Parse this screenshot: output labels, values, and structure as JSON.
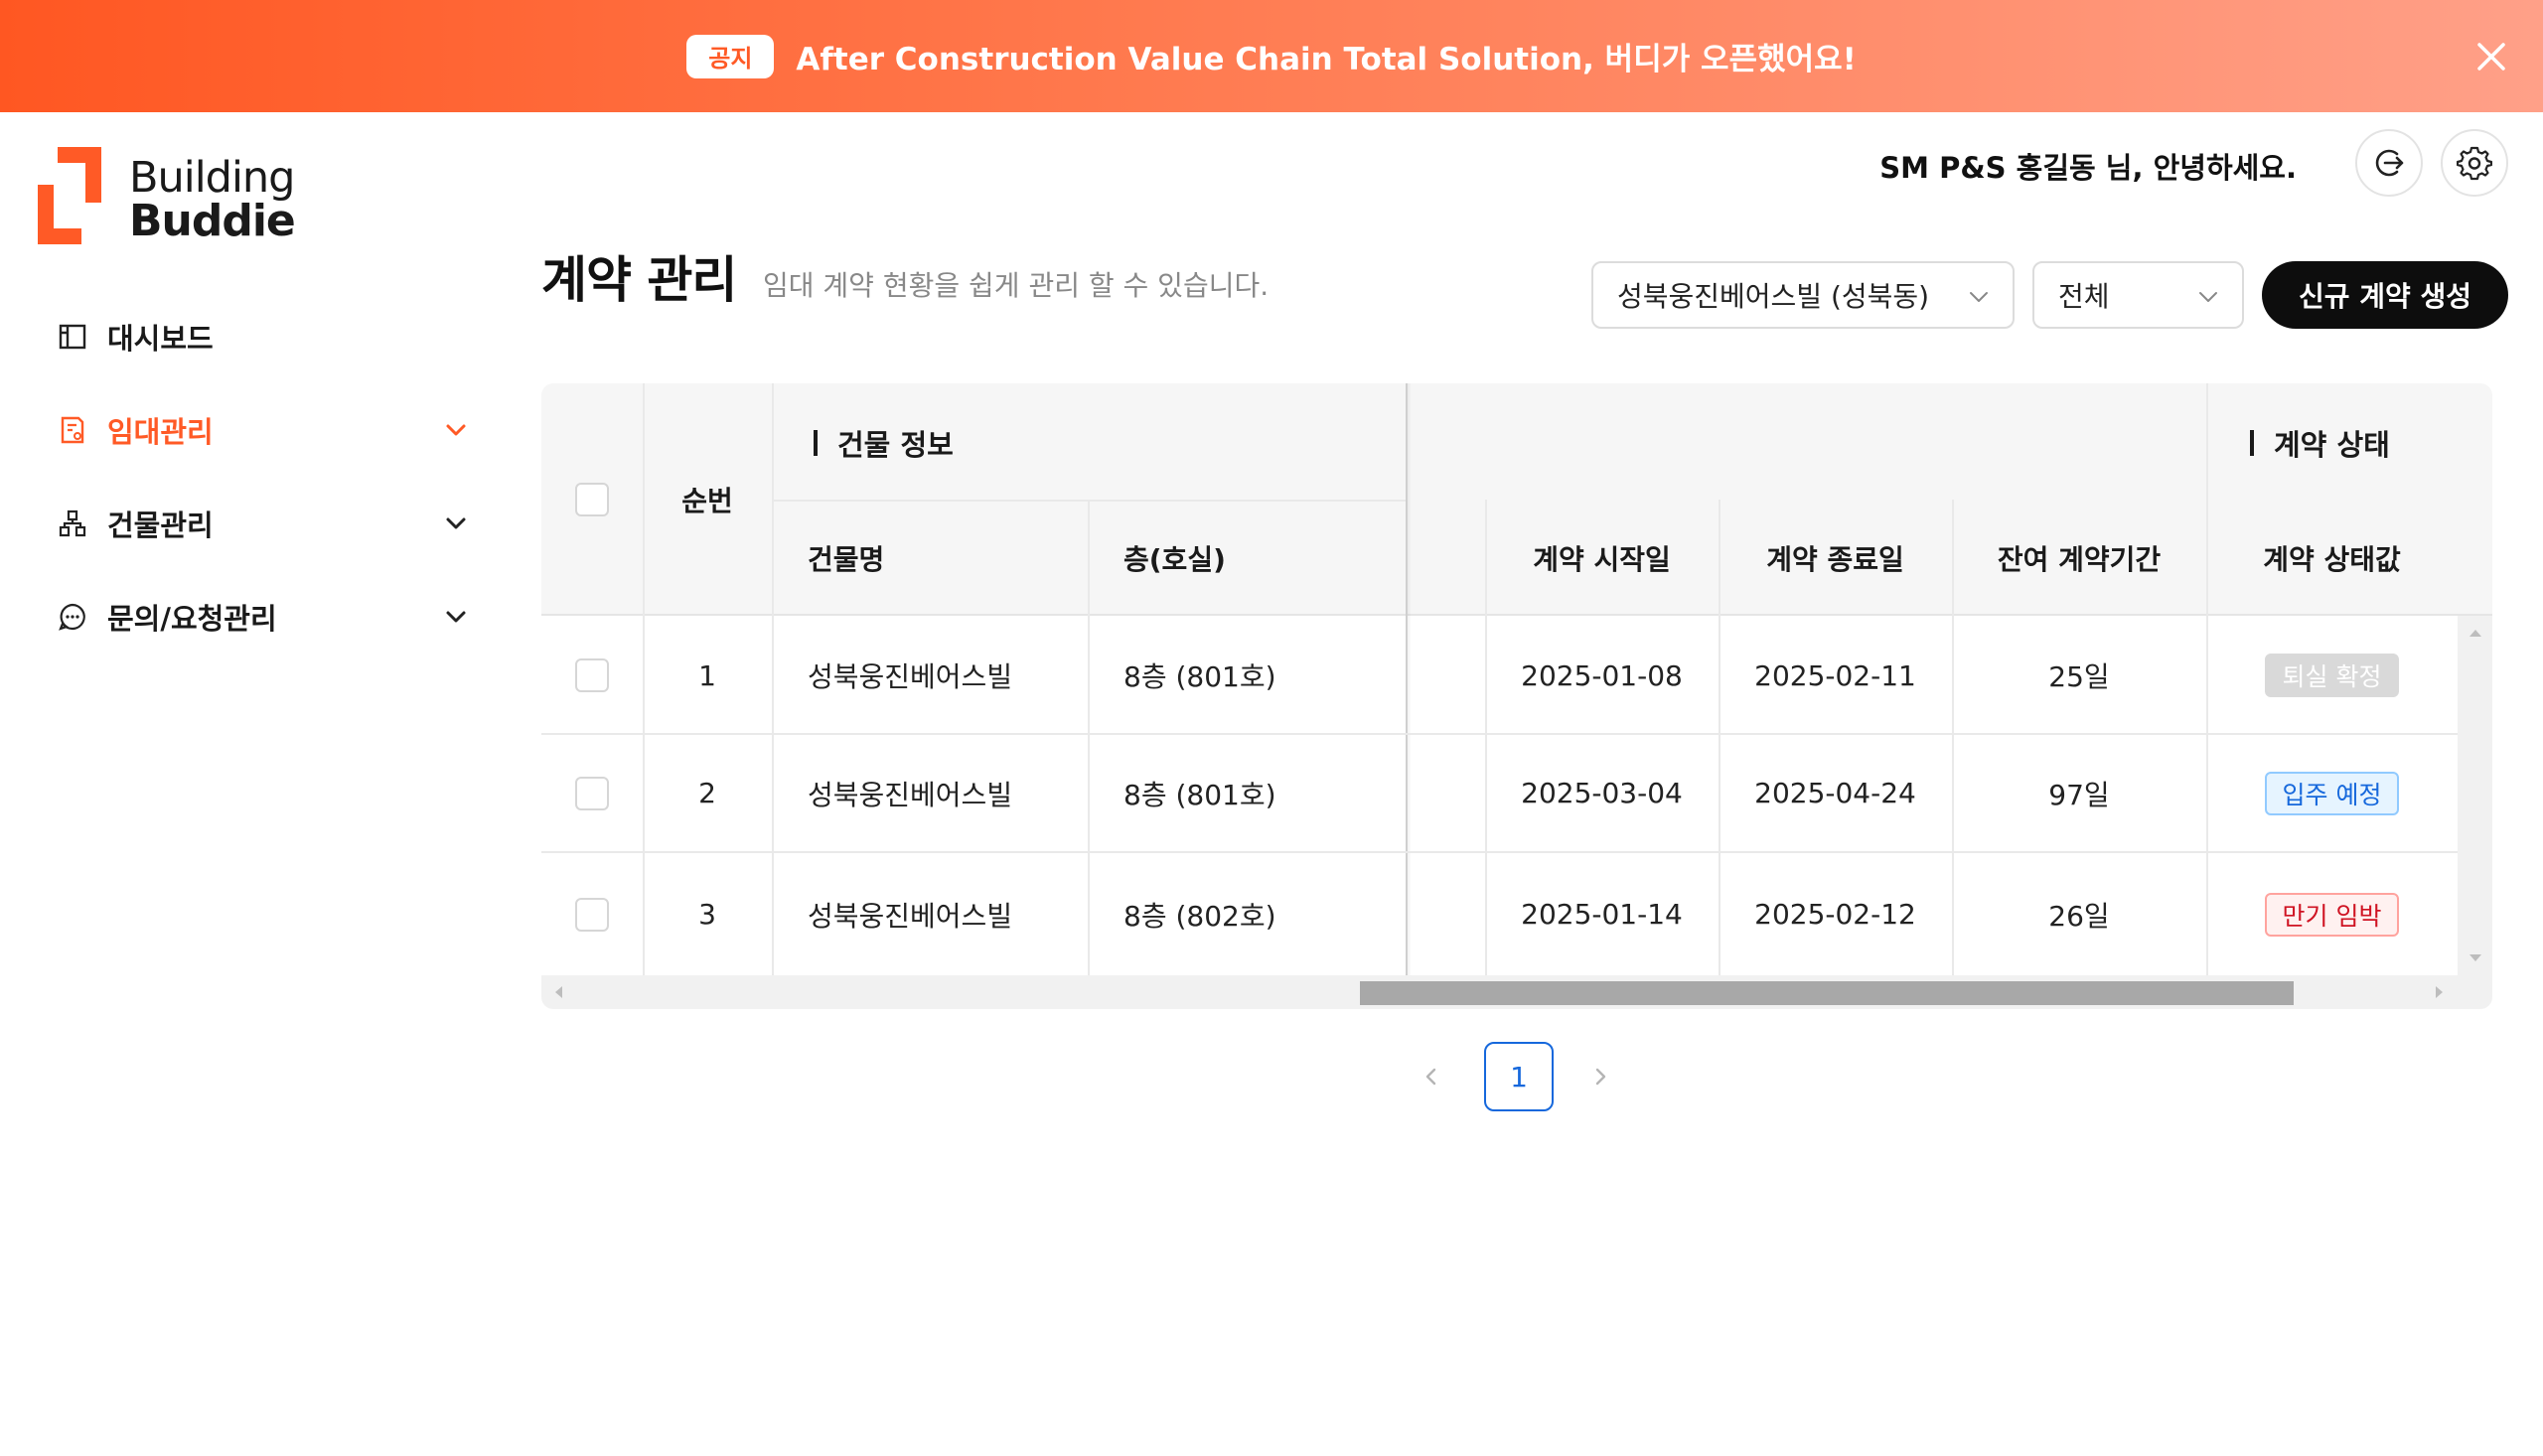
{
  "banner": {
    "tag": "공지",
    "message": "After Construction Value Chain Total Solution, 버디가 오픈했어요!"
  },
  "logo": {
    "line1": "Building",
    "line2": "Buddie"
  },
  "sidebar": {
    "items": [
      {
        "label": "대시보드",
        "icon": "dashboard-icon",
        "active": false
      },
      {
        "label": "임대관리",
        "icon": "lease-document-icon",
        "active": true
      },
      {
        "label": "건물관리",
        "icon": "building-hierarchy-icon",
        "active": false
      },
      {
        "label": "문의/요청관리",
        "icon": "chat-bubble-icon",
        "active": false
      }
    ]
  },
  "header": {
    "greeting": "SM P&S 홍길동 님, 안녕하세요."
  },
  "page": {
    "title": "계약 관리",
    "description": "임대 계약 현황을 쉽게 관리 할 수 있습니다.",
    "building_select": "성북웅진베어스빌 (성북동)",
    "status_select": "전체",
    "create_button": "신규 계약 생성"
  },
  "table": {
    "group_building": "건물 정보",
    "group_status": "계약 상태",
    "columns": {
      "index": "순번",
      "building": "건물명",
      "floor": "층(호실)",
      "start": "계약 시작일",
      "end": "계약 종료일",
      "remaining": "잔여 계약기간",
      "status": "계약 상태값"
    },
    "rows": [
      {
        "index": "1",
        "building": "성북웅진베어스빌",
        "floor": "8층 (801호)",
        "start": "2025-01-08",
        "end": "2025-02-11",
        "remaining": "25일",
        "status": "퇴실 확정"
      },
      {
        "index": "2",
        "building": "성북웅진베어스빌",
        "floor": "8층 (801호)",
        "start": "2025-03-04",
        "end": "2025-04-24",
        "remaining": "97일",
        "status": "입주 예정"
      },
      {
        "index": "3",
        "building": "성북웅진베어스빌",
        "floor": "8층 (802호)",
        "start": "2025-01-14",
        "end": "2025-02-12",
        "remaining": "26일",
        "status": "만기 임박"
      }
    ]
  },
  "pagination": {
    "current": "1"
  },
  "colors": {
    "accent": "#ff5a26",
    "badge_gray_bg": "#d9d9d9",
    "badge_blue_border": "#91caff",
    "badge_red_border": "#ffa39e",
    "page_active": "#1668dc"
  }
}
